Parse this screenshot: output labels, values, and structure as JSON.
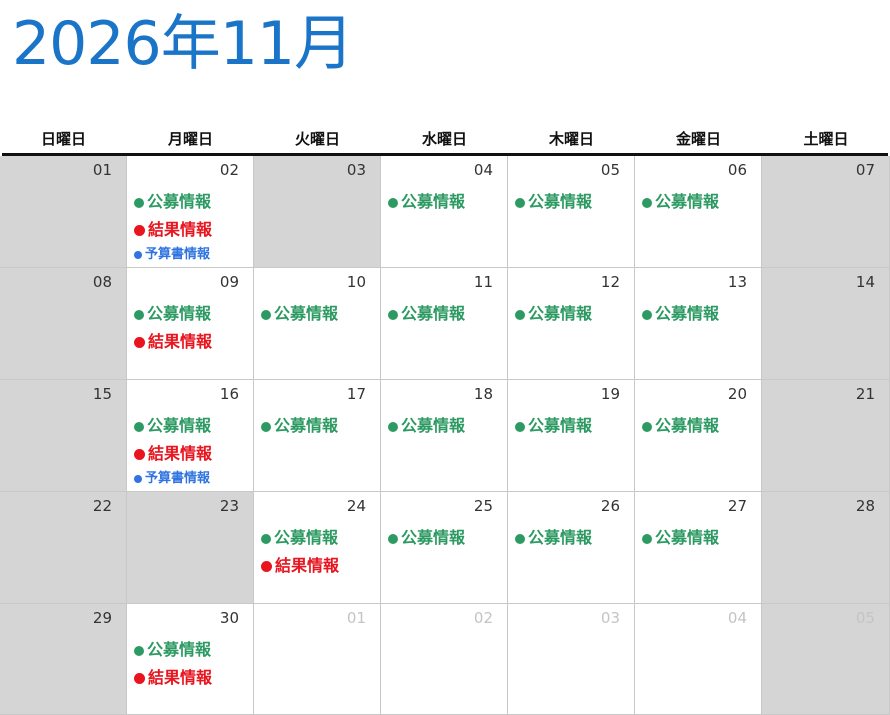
{
  "calendar": {
    "title": "2026年11月",
    "weekdays": [
      "日曜日",
      "月曜日",
      "火曜日",
      "水曜日",
      "木曜日",
      "金曜日",
      "土曜日"
    ],
    "categories": {
      "kobo": {
        "label": "公募情報",
        "color": "#2e9a63"
      },
      "kekka": {
        "label": "結果情報",
        "color": "#e8141e"
      },
      "yosan": {
        "label": "予算書情報",
        "color": "#2f74e0"
      }
    },
    "weeks": [
      [
        {
          "day": "01",
          "closed": true,
          "events": []
        },
        {
          "day": "02",
          "events": [
            "kobo",
            "kekka",
            "yosan"
          ]
        },
        {
          "day": "03",
          "closed": true,
          "events": []
        },
        {
          "day": "04",
          "events": [
            "kobo"
          ]
        },
        {
          "day": "05",
          "events": [
            "kobo"
          ]
        },
        {
          "day": "06",
          "events": [
            "kobo"
          ]
        },
        {
          "day": "07",
          "closed": true,
          "events": []
        }
      ],
      [
        {
          "day": "08",
          "closed": true,
          "events": []
        },
        {
          "day": "09",
          "events": [
            "kobo",
            "kekka"
          ]
        },
        {
          "day": "10",
          "events": [
            "kobo"
          ]
        },
        {
          "day": "11",
          "events": [
            "kobo"
          ]
        },
        {
          "day": "12",
          "events": [
            "kobo"
          ]
        },
        {
          "day": "13",
          "events": [
            "kobo"
          ]
        },
        {
          "day": "14",
          "closed": true,
          "events": []
        }
      ],
      [
        {
          "day": "15",
          "closed": true,
          "events": []
        },
        {
          "day": "16",
          "events": [
            "kobo",
            "kekka",
            "yosan"
          ]
        },
        {
          "day": "17",
          "events": [
            "kobo"
          ]
        },
        {
          "day": "18",
          "events": [
            "kobo"
          ]
        },
        {
          "day": "19",
          "events": [
            "kobo"
          ]
        },
        {
          "day": "20",
          "events": [
            "kobo"
          ]
        },
        {
          "day": "21",
          "closed": true,
          "events": []
        }
      ],
      [
        {
          "day": "22",
          "closed": true,
          "events": []
        },
        {
          "day": "23",
          "closed": true,
          "events": []
        },
        {
          "day": "24",
          "events": [
            "kobo",
            "kekka"
          ]
        },
        {
          "day": "25",
          "events": [
            "kobo"
          ]
        },
        {
          "day": "26",
          "events": [
            "kobo"
          ]
        },
        {
          "day": "27",
          "events": [
            "kobo"
          ]
        },
        {
          "day": "28",
          "closed": true,
          "events": []
        }
      ],
      [
        {
          "day": "29",
          "closed": true,
          "events": []
        },
        {
          "day": "30",
          "events": [
            "kobo",
            "kekka"
          ]
        },
        {
          "day": "01",
          "other": true,
          "events": []
        },
        {
          "day": "02",
          "other": true,
          "events": []
        },
        {
          "day": "03",
          "other": true,
          "events": []
        },
        {
          "day": "04",
          "other": true,
          "events": []
        },
        {
          "day": "05",
          "other": true,
          "closed": true,
          "events": []
        }
      ]
    ]
  }
}
